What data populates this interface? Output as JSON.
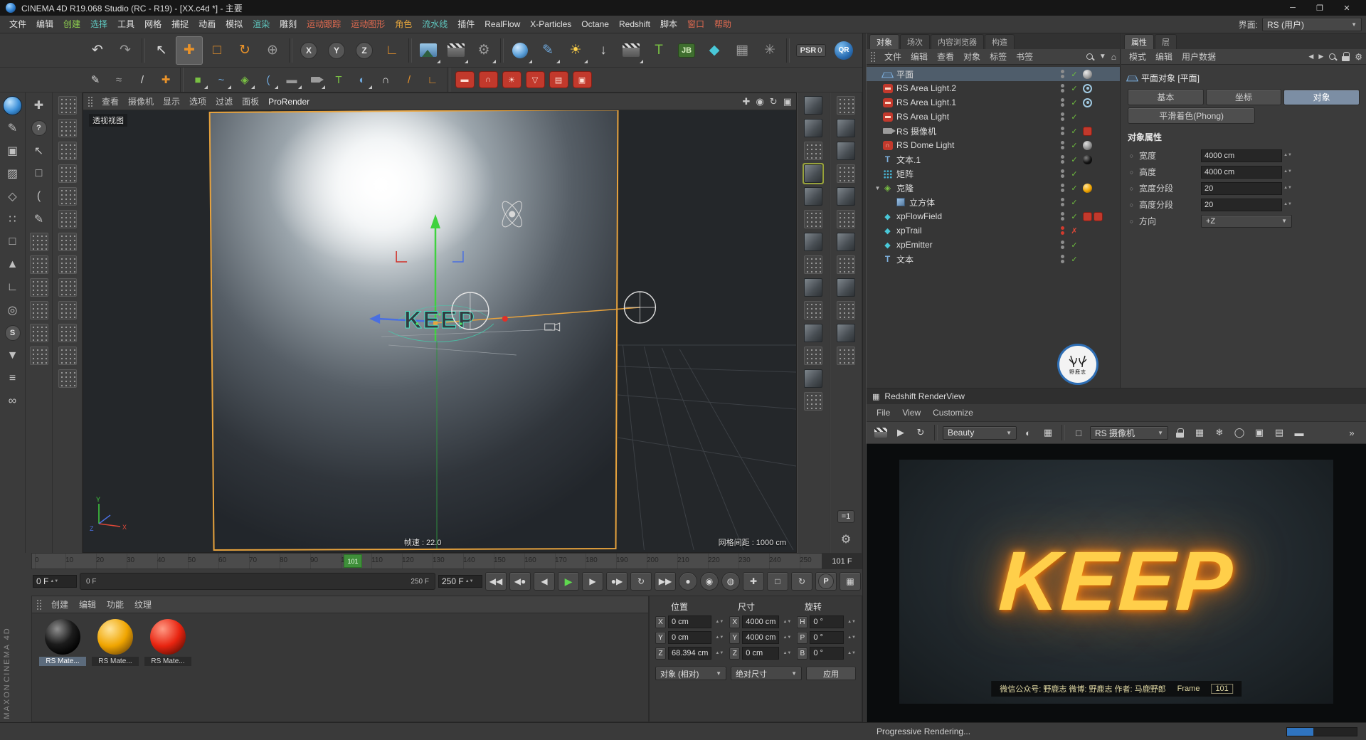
{
  "window": {
    "title": "CINEMA 4D R19.068 Studio (RC - R19) - [XX.c4d *] - 主要",
    "minimize": "─",
    "maximize": "❐",
    "close": "✕"
  },
  "menu_bar": {
    "items": [
      {
        "label": "文件",
        "color": "#e2e2e2"
      },
      {
        "label": "编辑",
        "color": "#e2e2e2"
      },
      {
        "label": "创建",
        "color": "#8fd14f"
      },
      {
        "label": "选择",
        "color": "#5fc8c0"
      },
      {
        "label": "工具",
        "color": "#e2e2e2"
      },
      {
        "label": "网格",
        "color": "#e2e2e2"
      },
      {
        "label": "捕捉",
        "color": "#e2e2e2"
      },
      {
        "label": "动画",
        "color": "#e2e2e2"
      },
      {
        "label": "模拟",
        "color": "#e2e2e2"
      },
      {
        "label": "渲染",
        "color": "#5fc8c0"
      },
      {
        "label": "雕刻",
        "color": "#e2e2e2"
      },
      {
        "label": "运动跟踪",
        "color": "#e06a50"
      },
      {
        "label": "运动图形",
        "color": "#e06a50"
      },
      {
        "label": "角色",
        "color": "#e0a23c"
      },
      {
        "label": "流水线",
        "color": "#5fc8c0"
      },
      {
        "label": "插件",
        "color": "#e2e2e2"
      },
      {
        "label": "RealFlow",
        "color": "#e2e2e2"
      },
      {
        "label": "X-Particles",
        "color": "#e2e2e2"
      },
      {
        "label": "Octane",
        "color": "#e2e2e2"
      },
      {
        "label": "Redshift",
        "color": "#e2e2e2"
      },
      {
        "label": "脚本",
        "color": "#e2e2e2"
      },
      {
        "label": "窗口",
        "color": "#e06a50"
      },
      {
        "label": "帮助",
        "color": "#e06a50"
      }
    ],
    "interface_label": "界面:",
    "interface_value": "RS (用户)"
  },
  "toolbar1": {
    "x": "X",
    "y": "Y",
    "z": "Z",
    "psr_label": "PSR",
    "psr_value": "0",
    "qr_label": "QR",
    "jb_label": "JB"
  },
  "toolbar2": {
    "t_label": "T"
  },
  "strips": {
    "s_label": "S",
    "help_label": "?",
    "solo_label": "=1"
  },
  "viewport": {
    "menu": [
      "查看",
      "摄像机",
      "显示",
      "选项",
      "过滤",
      "面板"
    ],
    "prorender": "ProRender",
    "view_label": "透视视图",
    "fps_label": "帧速 : 22.0",
    "grid_label": "网格间距 : 1000 cm",
    "object_label": "KEEP",
    "axis": {
      "x": "X",
      "y": "Y",
      "z": "Z"
    }
  },
  "timeline": {
    "ticks": [
      "0",
      "10",
      "20",
      "30",
      "40",
      "50",
      "60",
      "70",
      "80",
      "90",
      "100",
      "110",
      "120",
      "130",
      "140",
      "150",
      "160",
      "170",
      "180",
      "190",
      "200",
      "210",
      "220",
      "230",
      "240",
      "250"
    ],
    "playhead": "101",
    "current_frame": "101 F",
    "start_frame": "0 F",
    "end_frame": "250 F",
    "range_start": "0 F",
    "range_end": "250 F",
    "p_label": "P"
  },
  "materials": {
    "menu": [
      "创建",
      "编辑",
      "功能",
      "纹理"
    ],
    "items": [
      {
        "name": "RS Mate...",
        "colors": [
          "#8f8f8f",
          "#1c1c1c",
          "#000000"
        ]
      },
      {
        "name": "RS Mate...",
        "colors": [
          "#ffe49a",
          "#f0a500",
          "#70480a"
        ]
      },
      {
        "name": "RS Mate...",
        "colors": [
          "#ff9a84",
          "#e82410",
          "#5c0e04"
        ]
      }
    ]
  },
  "brand": {
    "maxon": "MAXON",
    "cinema": "CINEMA 4D"
  },
  "coordinates": {
    "headers": [
      "位置",
      "尺寸",
      "旋转"
    ],
    "position": {
      "x_label": "X",
      "x": "0 cm",
      "y_label": "Y",
      "y": "0 cm",
      "z_label": "Z",
      "z": "68.394 cm"
    },
    "size": {
      "x_label": "X",
      "x": "4000 cm",
      "y_label": "Y",
      "y": "4000 cm",
      "z_label": "Z",
      "z": "0 cm"
    },
    "rotation": {
      "h_label": "H",
      "h": "0 °",
      "p_label": "P",
      "p": "0 °",
      "b_label": "B",
      "b": "0 °"
    },
    "mode_dropdown": "对象 (相对)",
    "size_dropdown": "绝对尺寸",
    "apply_button": "应用"
  },
  "object_manager": {
    "tabs": [
      "对象",
      "场次",
      "内容浏览器",
      "构造"
    ],
    "menu": [
      "文件",
      "编辑",
      "查看",
      "对象",
      "标签",
      "书签"
    ],
    "items": [
      {
        "name": "平面"
      },
      {
        "name": "RS Area Light.2"
      },
      {
        "name": "RS Area Light.1"
      },
      {
        "name": "RS Area Light"
      },
      {
        "name": "RS 摄像机"
      },
      {
        "name": "RS Dome Light"
      },
      {
        "name": "文本.1"
      },
      {
        "name": "矩阵"
      },
      {
        "name": "克隆"
      },
      {
        "name": "立方体"
      },
      {
        "name": "xpFlowField"
      },
      {
        "name": "xpTrail"
      },
      {
        "name": "xpEmitter"
      },
      {
        "name": "文本"
      }
    ]
  },
  "attributes": {
    "tabs": [
      "属性",
      "层"
    ],
    "menu": [
      "模式",
      "编辑",
      "用户数据"
    ],
    "object_title": "平面对象 [平面]",
    "section_tabs": [
      "基本",
      "坐标",
      "对象"
    ],
    "phong_tab": "平滑着色(Phong)",
    "section_header": "对象属性",
    "props": [
      {
        "label": "宽度",
        "value": "4000 cm"
      },
      {
        "label": "高度",
        "value": "4000 cm"
      },
      {
        "label": "宽度分段",
        "value": "20"
      },
      {
        "label": "高度分段",
        "value": "20"
      },
      {
        "label": "方向",
        "value": "+Z"
      }
    ]
  },
  "badge": {
    "text": "野鹿志"
  },
  "renderview": {
    "title": "Redshift RenderView",
    "menu": [
      "File",
      "View",
      "Customize"
    ],
    "beauty_dropdown": "Beauty",
    "camera_dropdown": "RS 摄像机",
    "keep_text": "KEEP",
    "caption": "微信公众号: 野鹿志  微博: 野鹿志  作者: 马鹿野郎",
    "frame_label": "Frame",
    "frame_value": "101"
  },
  "status_bar": {
    "text": "Progressive Rendering..."
  }
}
